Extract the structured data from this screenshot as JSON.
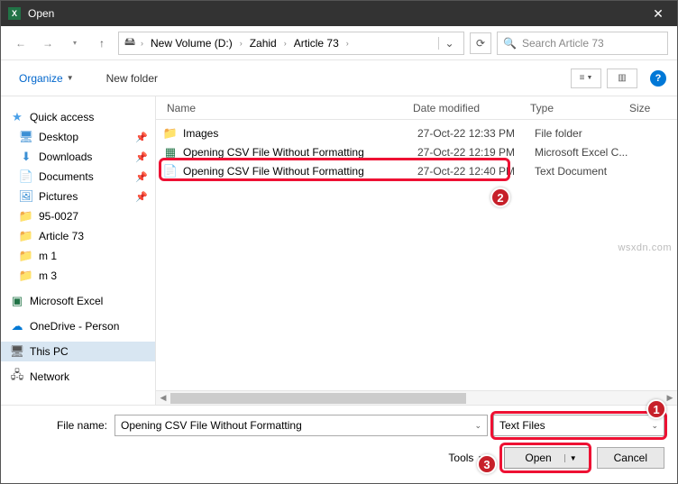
{
  "titlebar": {
    "title": "Open"
  },
  "breadcrumb": {
    "items": [
      "New Volume (D:)",
      "Zahid",
      "Article 73"
    ]
  },
  "search": {
    "placeholder": "Search Article 73"
  },
  "toolbar": {
    "organize": "Organize",
    "newfolder": "New folder"
  },
  "columns": {
    "name": "Name",
    "date": "Date modified",
    "type": "Type",
    "size": "Size"
  },
  "sidebar": {
    "quick": "Quick access",
    "items": [
      "Desktop",
      "Downloads",
      "Documents",
      "Pictures",
      "95-0027",
      "Article 73",
      "m 1",
      "m 3"
    ],
    "excel": "Microsoft Excel",
    "onedrive": "OneDrive - Person",
    "thispc": "This PC",
    "network": "Network"
  },
  "files": [
    {
      "name": "Images",
      "date": "27-Oct-22 12:33 PM",
      "type": "File folder"
    },
    {
      "name": "Opening CSV File Without Formatting",
      "date": "27-Oct-22 12:19 PM",
      "type": "Microsoft Excel C..."
    },
    {
      "name": "Opening CSV File Without Formatting",
      "date": "27-Oct-22 12:40 PM",
      "type": "Text Document"
    }
  ],
  "footer": {
    "filename_label": "File name:",
    "filename_value": "Opening CSV File Without Formatting",
    "filter": "Text Files",
    "tools": "Tools",
    "open": "Open",
    "cancel": "Cancel"
  },
  "watermark": "wsxdn.com",
  "badges": {
    "b1": "1",
    "b2": "2",
    "b3": "3"
  }
}
